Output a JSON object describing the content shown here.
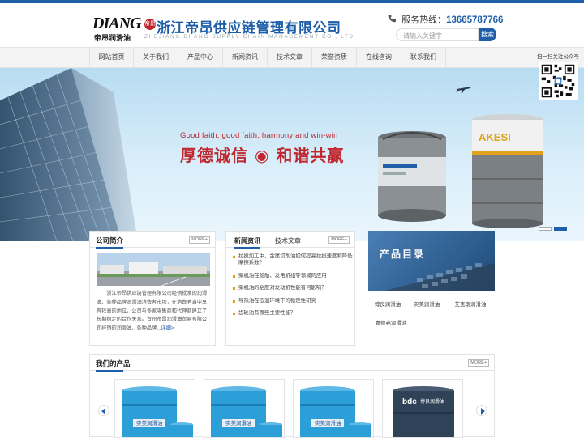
{
  "header": {
    "logo_big": "DIANG",
    "logo_small": "帝昂润滑油",
    "logo_seal": "帝昂",
    "company_cn": "浙江帝昂供应链管理有限公司",
    "company_en": "ZHEJIANG DI ANG SUPPLY CHAIN MANAGEMENT CO., LTD",
    "hotline_label": "服务热线：",
    "hotline_number": "13665787766",
    "search_placeholder": "请输入关键字",
    "search_button": "搜索"
  },
  "nav": {
    "items": [
      "网站首页",
      "关于我们",
      "产品中心",
      "新闻资讯",
      "技术文章",
      "荣誉资质",
      "在线咨询",
      "联系我们"
    ]
  },
  "qr": {
    "label": "扫一扫关注公众号"
  },
  "banner": {
    "slogan_en": "Good faith, good faith, harmony and win-win",
    "slogan_cn": "厚德诚信 ◉ 和谐共赢",
    "drum_brand": "AKESI 艾克斯",
    "slide_count": 2,
    "active_slide": 1
  },
  "about": {
    "title": "公司简介",
    "more": "MORE+",
    "text": "浙江帝昂供应链管理有限公司经销批发的润滑油、各种品牌润滑油消费者市场，在消费者当中享有较高的地位，公司与多家零售商和代理商建立了长期稳定的合作关系。台州帝昂润滑油贸易有限公司经销的润滑油、各种品牌...",
    "detail_link": "详细>"
  },
  "news": {
    "tabs": [
      "新闻资讯",
      "技术文章"
    ],
    "more": "MORE+",
    "items": [
      "拉拔加工中，金属切削油如何提高拉拔速度和降低摩擦系数？",
      "柴机油在船舶、发电机组等领域的应用",
      "柴机油的粘度对发动机性能有何影响？",
      "导热油在低温环境下的稳定性研究",
      "齿轮油有哪些主要性能？"
    ]
  },
  "products": {
    "title": "产品目录",
    "links": [
      "博良润滑油",
      "实美润滑油",
      "艾克斯润滑油",
      "嘉德弗润滑油"
    ]
  },
  "our_products": {
    "title": "我们的产品",
    "more": "MORE+",
    "cards": [
      {
        "label": "实美润滑油"
      },
      {
        "label": "实美润滑油"
      },
      {
        "label": "实美润滑油"
      },
      {
        "label": "博良润滑油"
      }
    ]
  },
  "colors": {
    "brand_blue": "#1f5ea8",
    "slogan_red": "#c0262d",
    "accent_orange": "#e89a1f"
  }
}
